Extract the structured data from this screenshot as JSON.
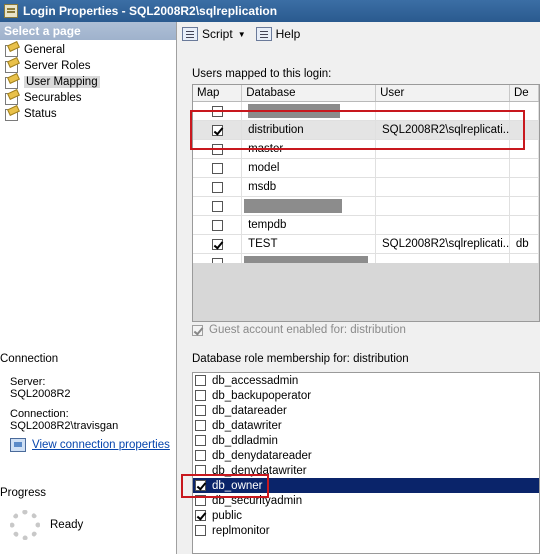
{
  "window": {
    "title": "Login Properties - SQL2008R2\\sqlreplication"
  },
  "select_page": {
    "header": "Select a page",
    "items": [
      {
        "label": "General",
        "selected": false
      },
      {
        "label": "Server Roles",
        "selected": false
      },
      {
        "label": "User Mapping",
        "selected": true
      },
      {
        "label": "Securables",
        "selected": false
      },
      {
        "label": "Status",
        "selected": false
      }
    ]
  },
  "connection": {
    "header": "Connection",
    "server_label": "Server:",
    "server_value": "SQL2008R2",
    "connection_label": "Connection:",
    "connection_value": "SQL2008R2\\travisgan",
    "view_link": "View connection properties"
  },
  "progress": {
    "header": "Progress",
    "status": "Ready"
  },
  "toolbar": {
    "script_label": "Script",
    "help_label": "Help"
  },
  "users_mapped": {
    "label": "Users mapped to this login:",
    "columns": [
      "Map",
      "Database",
      "User",
      "De"
    ],
    "rows": [
      {
        "map": false,
        "database": "",
        "user": "",
        "redacted": true
      },
      {
        "map": true,
        "database": "distribution",
        "user": "SQL2008R2\\sqlreplicati...",
        "selected": true
      },
      {
        "map": false,
        "database": "master",
        "user": ""
      },
      {
        "map": false,
        "database": "model",
        "user": ""
      },
      {
        "map": false,
        "database": "msdb",
        "user": ""
      },
      {
        "map": false,
        "database": "",
        "user": "",
        "redacted": true
      },
      {
        "map": false,
        "database": "tempdb",
        "user": ""
      },
      {
        "map": true,
        "database": "TEST",
        "user": "SQL2008R2\\sqlreplicati...",
        "default_schema": "db"
      },
      {
        "map": false,
        "database": "",
        "user": "",
        "redacted": true
      }
    ]
  },
  "guest": {
    "label": "Guest account enabled for: distribution",
    "checked": true
  },
  "roles": {
    "label": "Database role membership for: distribution",
    "items": [
      {
        "name": "db_accessadmin",
        "checked": false
      },
      {
        "name": "db_backupoperator",
        "checked": false
      },
      {
        "name": "db_datareader",
        "checked": false
      },
      {
        "name": "db_datawriter",
        "checked": false
      },
      {
        "name": "db_ddladmin",
        "checked": false
      },
      {
        "name": "db_denydatareader",
        "checked": false
      },
      {
        "name": "db_denydatawriter",
        "checked": false
      },
      {
        "name": "db_owner",
        "checked": true,
        "selected": true
      },
      {
        "name": "db_securityadmin",
        "checked": false
      },
      {
        "name": "public",
        "checked": true
      },
      {
        "name": "replmonitor",
        "checked": false
      }
    ]
  },
  "colors": {
    "title_bar": "#2f5f96",
    "selection": "#0a246a",
    "highlight_box": "#c8181e",
    "link": "#0645ad"
  }
}
